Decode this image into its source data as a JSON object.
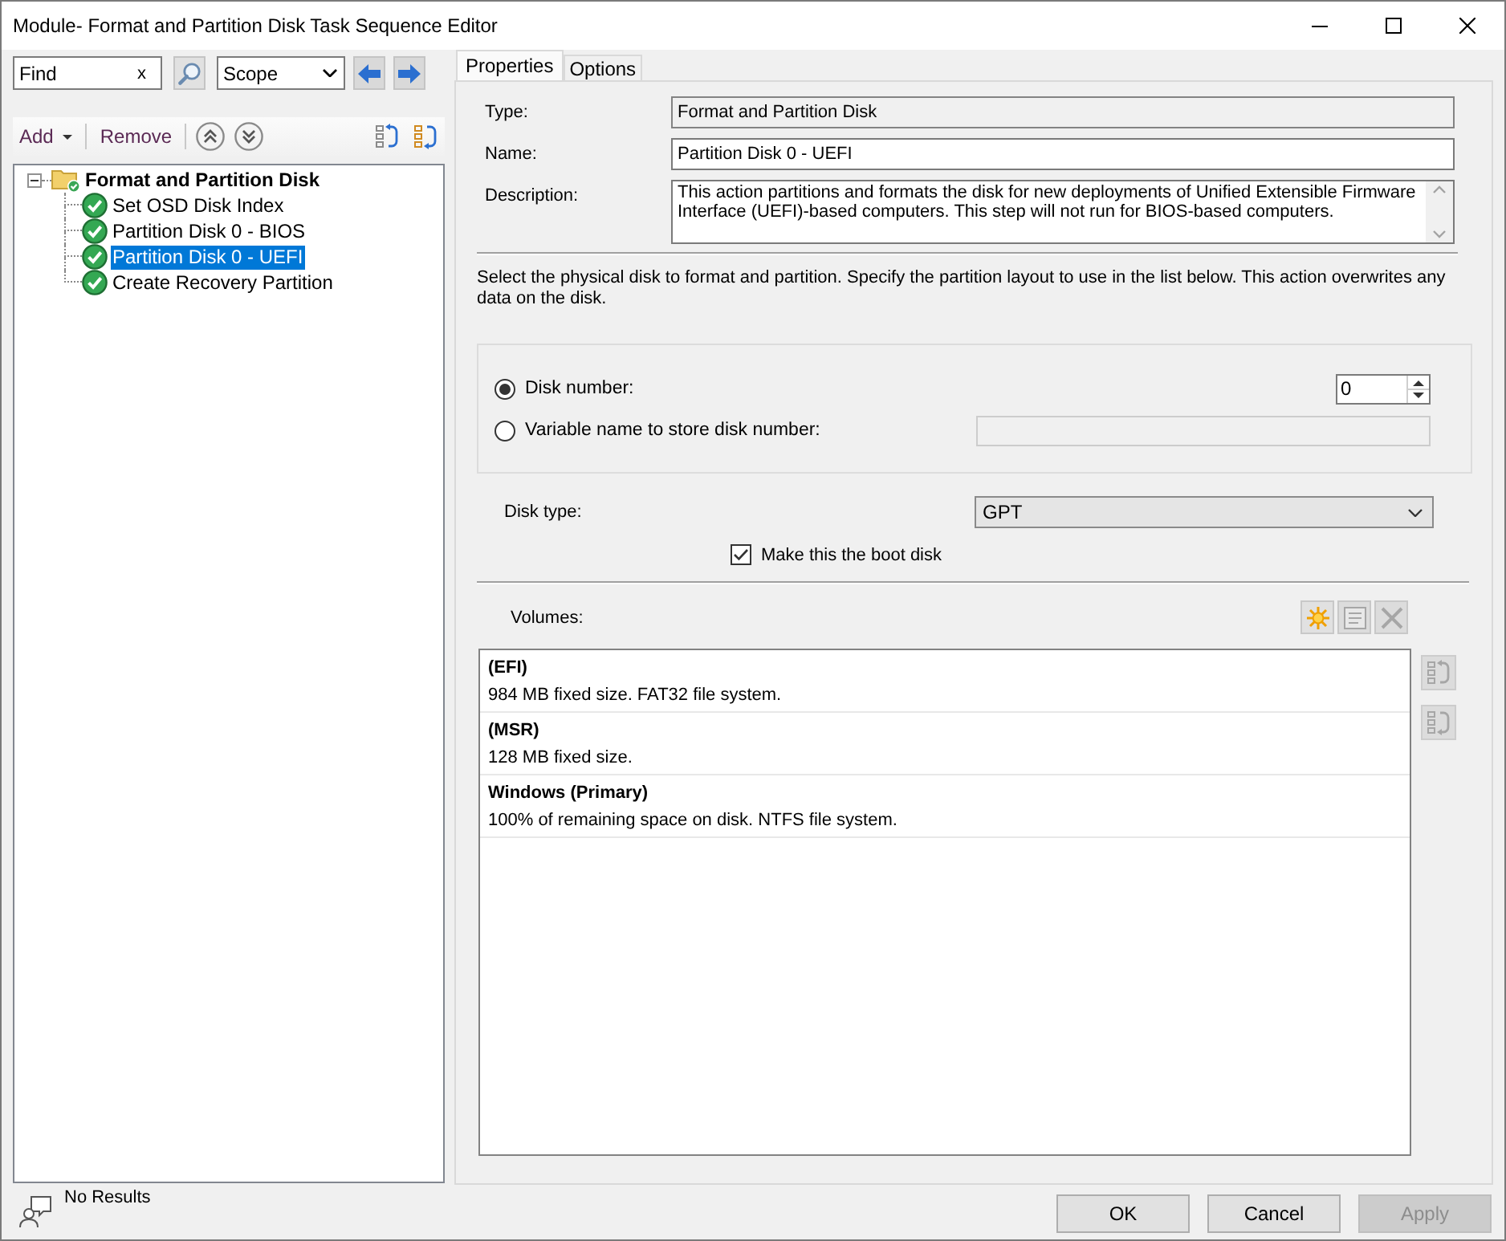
{
  "window": {
    "title": "Module- Format and Partition Disk Task Sequence Editor"
  },
  "search": {
    "value": "Find",
    "clear": "x"
  },
  "scope": {
    "value": "Scope"
  },
  "toolbar": {
    "add": "Add",
    "remove": "Remove"
  },
  "tree": {
    "label": "Format and Partition Disk",
    "selected": false,
    "expanded": true,
    "children": [
      {
        "label": "Set OSD Disk Index",
        "selected": false
      },
      {
        "label": "Partition Disk 0 - BIOS",
        "selected": false
      },
      {
        "label": "Partition Disk 0 - UEFI",
        "selected": true
      },
      {
        "label": "Create Recovery Partition",
        "selected": false
      }
    ]
  },
  "status_bar": {
    "text": "No Results"
  },
  "tabs": [
    {
      "label": "Properties",
      "selected": true
    },
    {
      "label": "Options",
      "selected": false
    }
  ],
  "properties": {
    "fields": [
      {
        "kind": "readonly",
        "label": "Type:",
        "value": "Format and Partition Disk"
      },
      {
        "kind": "text",
        "label": "Name:",
        "value": "Partition Disk 0 - UEFI"
      },
      {
        "kind": "multiline",
        "label": "Description:",
        "value": "This action partitions and formats the disk for new deployments of Unified Extensible Firmware Interface (UEFI)-based computers. This step will not run for BIOS-based computers."
      }
    ]
  },
  "instructions": "Select the physical disk to format and partition. Specify the partition layout to use in the list below. This action overwrites any data on the disk.",
  "disk_selection": {
    "options": [
      {
        "label": "Disk number:",
        "selected": true,
        "field": {
          "kind": "spinner",
          "value": "0",
          "disabled": false
        }
      },
      {
        "label": "Variable name to store disk number:",
        "selected": false,
        "field": {
          "kind": "text",
          "disabled": true
        }
      }
    ]
  },
  "disk_type": {
    "label": "Disk type:",
    "value": "GPT"
  },
  "boot_disk": {
    "label": "Make this the boot disk",
    "checked": true
  },
  "volumes": {
    "label": "Volumes:",
    "tools": [
      {
        "kind": "new",
        "disabled": false
      },
      {
        "kind": "properties",
        "disabled": true
      },
      {
        "kind": "delete",
        "disabled": true
      }
    ],
    "order_tools": [
      {
        "kind": "up",
        "disabled": true
      },
      {
        "kind": "down",
        "disabled": true
      }
    ],
    "items": [
      {
        "name": "(EFI)",
        "detail": "984 MB fixed size. FAT32 file system."
      },
      {
        "name": "(MSR)",
        "detail": "128 MB fixed size."
      },
      {
        "name": "Windows (Primary)",
        "detail": "100% of remaining space on disk. NTFS file system."
      }
    ]
  },
  "buttons": [
    {
      "label": "OK",
      "disabled": false
    },
    {
      "label": "Cancel",
      "disabled": false
    },
    {
      "label": "Apply",
      "disabled": true
    }
  ]
}
